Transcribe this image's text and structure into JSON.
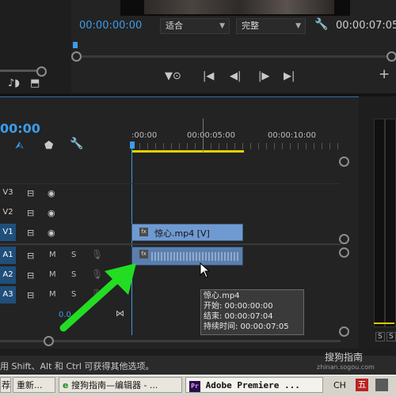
{
  "program_monitor": {
    "timecode": "00:00:00:00",
    "fit_value": "适合",
    "quality_value": "完整",
    "duration": "00:00:07:05"
  },
  "timeline": {
    "timecode": "00:00",
    "ruler_ticks": [
      ":00:00",
      "00:00:05:00",
      "00:00:10:00"
    ],
    "tracks": [
      {
        "id": "V3",
        "active": false
      },
      {
        "id": "V2",
        "active": false
      },
      {
        "id": "V1",
        "active": true
      },
      {
        "id": "A1",
        "active": true,
        "m": "M",
        "s": "S"
      },
      {
        "id": "A2",
        "active": true,
        "m": "M",
        "s": "S"
      },
      {
        "id": "A3",
        "active": true,
        "m": "M",
        "s": "S"
      }
    ],
    "video_clip_label": "惊心.mp4 [V]",
    "audio_volume": "0.0",
    "tooltip": {
      "name": "惊心.mp4",
      "start": "开始: 00:00:00:00",
      "end": "结束: 00:00:07:04",
      "duration": "持续时间: 00:00:07:05"
    }
  },
  "audio_meter": {
    "s1": "S",
    "s2": "S"
  },
  "status_bar": {
    "hint": "用 Shift、Alt 和 Ctrl 可获得其他选项。"
  },
  "taskbar": {
    "item1": "荐",
    "item2": "重新...",
    "item3": "搜狗指南—编辑器 - ...",
    "item4": "Adobe Premiere ...",
    "lang": "CH",
    "ime": "五"
  },
  "watermark": {
    "name": "搜狗指南",
    "url": "zhinan.sogou.com"
  },
  "colors": {
    "accent": "#3d9be9",
    "clip_video": "#6f9ad1",
    "clip_audio": "#5a7fae",
    "arrow": "#22dd22",
    "work_area": "#e3d200"
  }
}
